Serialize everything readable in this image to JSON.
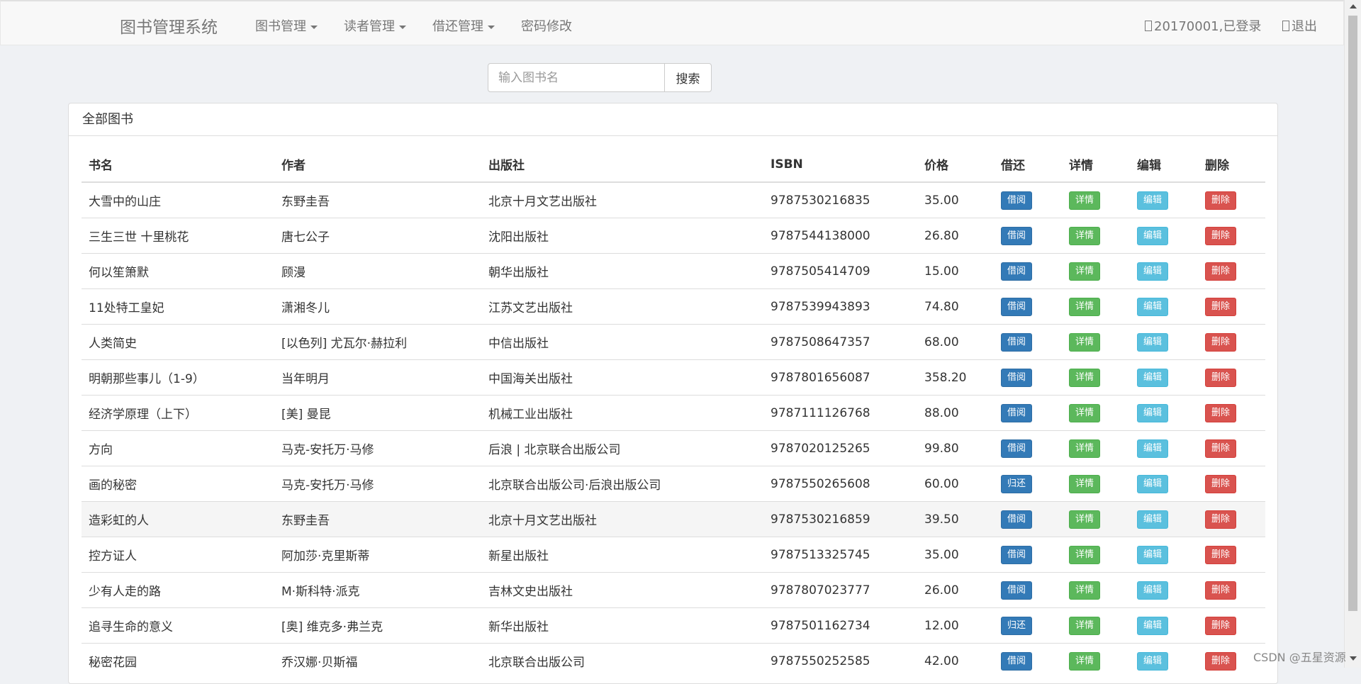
{
  "navbar": {
    "brand": "图书管理系统",
    "menu": [
      {
        "label": "图书管理",
        "dropdown": true
      },
      {
        "label": "读者管理",
        "dropdown": true
      },
      {
        "label": "借还管理",
        "dropdown": true
      },
      {
        "label": "密码修改",
        "dropdown": false
      }
    ],
    "user_status": "20170001,已登录",
    "logout": "退出"
  },
  "search": {
    "placeholder": "输入图书名",
    "button": "搜索"
  },
  "panel": {
    "title": "全部图书"
  },
  "table": {
    "headers": [
      "书名",
      "作者",
      "出版社",
      "ISBN",
      "价格",
      "借还",
      "详情",
      "编辑",
      "删除"
    ],
    "buttons": {
      "detail": "详情",
      "edit": "编辑",
      "delete": "删除"
    },
    "rows": [
      {
        "title": "大雪中的山庄",
        "author": "东野圭吾",
        "publisher": "北京十月文艺出版社",
        "isbn": "9787530216835",
        "price": "35.00",
        "action": "借阅"
      },
      {
        "title": "三生三世 十里桃花",
        "author": "唐七公子",
        "publisher": "沈阳出版社",
        "isbn": "9787544138000",
        "price": "26.80",
        "action": "借阅"
      },
      {
        "title": "何以笙箫默",
        "author": "顾漫",
        "publisher": "朝华出版社",
        "isbn": "9787505414709",
        "price": "15.00",
        "action": "借阅"
      },
      {
        "title": "11处特工皇妃",
        "author": "潇湘冬儿",
        "publisher": "江苏文艺出版社",
        "isbn": "9787539943893",
        "price": "74.80",
        "action": "借阅"
      },
      {
        "title": "人类简史",
        "author": "[以色列] 尤瓦尔·赫拉利",
        "publisher": "中信出版社",
        "isbn": "9787508647357",
        "price": "68.00",
        "action": "借阅"
      },
      {
        "title": "明朝那些事儿（1-9）",
        "author": "当年明月",
        "publisher": "中国海关出版社",
        "isbn": "9787801656087",
        "price": "358.20",
        "action": "借阅"
      },
      {
        "title": "经济学原理（上下）",
        "author": "[美] 曼昆",
        "publisher": "机械工业出版社",
        "isbn": "9787111126768",
        "price": "88.00",
        "action": "借阅"
      },
      {
        "title": "方向",
        "author": "马克-安托万·马修",
        "publisher": "后浪 | 北京联合出版公司",
        "isbn": "9787020125265",
        "price": "99.80",
        "action": "借阅"
      },
      {
        "title": "画的秘密",
        "author": "马克-安托万·马修",
        "publisher": "北京联合出版公司·后浪出版公司",
        "isbn": "9787550265608",
        "price": "60.00",
        "action": "归还"
      },
      {
        "title": "造彩虹的人",
        "author": "东野圭吾",
        "publisher": "北京十月文艺出版社",
        "isbn": "9787530216859",
        "price": "39.50",
        "action": "借阅"
      },
      {
        "title": "控方证人",
        "author": "阿加莎·克里斯蒂",
        "publisher": "新星出版社",
        "isbn": "9787513325745",
        "price": "35.00",
        "action": "借阅"
      },
      {
        "title": "少有人走的路",
        "author": "M·斯科特·派克",
        "publisher": "吉林文史出版社",
        "isbn": "9787807023777",
        "price": "26.00",
        "action": "借阅"
      },
      {
        "title": "追寻生命的意义",
        "author": "[奥] 维克多·弗兰克",
        "publisher": "新华出版社",
        "isbn": "9787501162734",
        "price": "12.00",
        "action": "归还"
      },
      {
        "title": "秘密花园",
        "author": "乔汉娜·贝斯福",
        "publisher": "北京联合出版公司",
        "isbn": "9787550252585",
        "price": "42.00",
        "action": "借阅"
      }
    ]
  },
  "watermark": "CSDN @五星资源"
}
